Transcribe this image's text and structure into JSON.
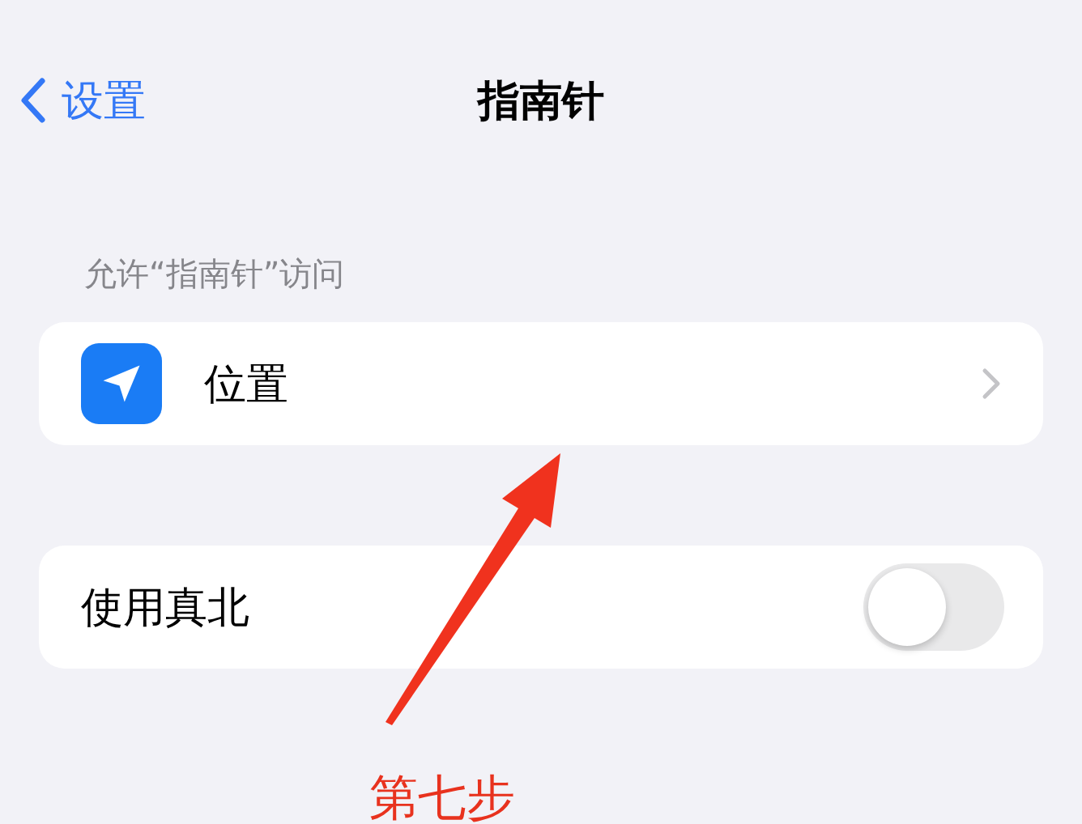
{
  "nav": {
    "back_label": "设置",
    "title": "指南针"
  },
  "section_header": "允许“指南针”访问",
  "location_row": {
    "label": "位置"
  },
  "true_north": {
    "label": "使用真北",
    "on": false
  },
  "annotation": {
    "text": "第七步"
  }
}
